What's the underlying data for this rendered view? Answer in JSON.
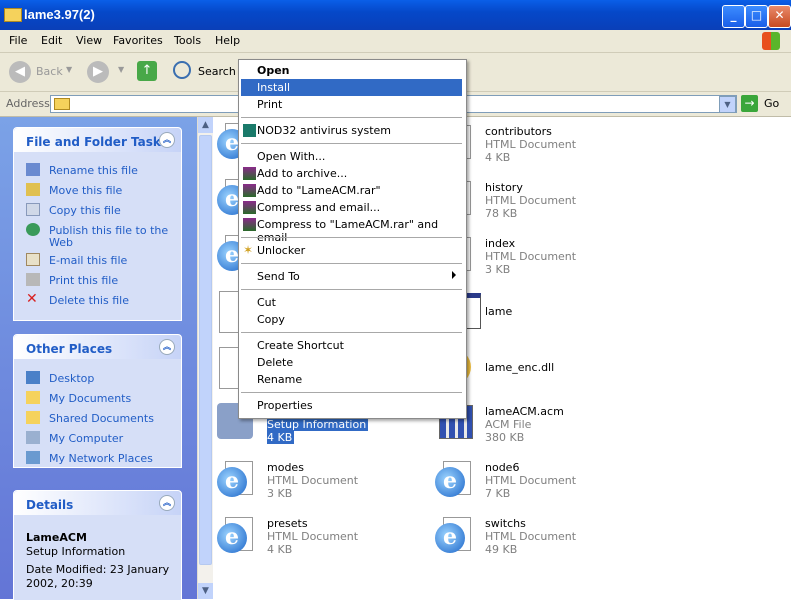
{
  "window": {
    "title": "lame3.97(2)"
  },
  "menubar": [
    "File",
    "Edit",
    "View",
    "Favorites",
    "Tools",
    "Help"
  ],
  "toolbar": {
    "back": "Back",
    "search": "Search"
  },
  "address": {
    "label": "Address",
    "value": "",
    "go": "Go"
  },
  "tasks": {
    "title": "File and Folder Tasks",
    "items": [
      "Rename this file",
      "Move this file",
      "Copy this file",
      "Publish this file to the",
      "Web",
      "E-mail this file",
      "Print this file",
      "Delete this file"
    ]
  },
  "places": {
    "title": "Other Places",
    "items": [
      "Desktop",
      "My Documents",
      "Shared Documents",
      "My Computer",
      "My Network Places"
    ]
  },
  "details": {
    "title": "Details",
    "name": "LameACM",
    "type": "Setup Information",
    "modified_line1": "Date Modified: 23 January",
    "modified_line2": "2002, 20:39"
  },
  "files_left": [
    {
      "name": "",
      "type": "",
      "size": ""
    },
    {
      "name": "",
      "type": "",
      "size": ""
    },
    {
      "name": "",
      "type": "",
      "size": ""
    },
    {
      "name": "",
      "type": "",
      "size": ""
    },
    {
      "name": "",
      "type": "",
      "size": ""
    },
    {
      "name": "",
      "type": "Setup Information",
      "size": "4 KB"
    },
    {
      "name": "modes",
      "type": "HTML Document",
      "size": "3 KB"
    },
    {
      "name": "presets",
      "type": "HTML Document",
      "size": "4 KB"
    }
  ],
  "files_right": [
    {
      "name": "contributors",
      "type": "HTML Document",
      "size": "4 KB"
    },
    {
      "name": "history",
      "type": "HTML Document",
      "size": "78 KB"
    },
    {
      "name": "index",
      "type": "HTML Document",
      "size": "3 KB"
    },
    {
      "name": "lame",
      "type": "",
      "size": ""
    },
    {
      "name": "lame_enc.dll",
      "type": "",
      "size": ""
    },
    {
      "name": "lameACM.acm",
      "type": "ACM File",
      "size": "380 KB"
    },
    {
      "name": "node6",
      "type": "HTML Document",
      "size": "7 KB"
    },
    {
      "name": "switchs",
      "type": "HTML Document",
      "size": "49 KB"
    }
  ],
  "context_menu": {
    "open": "Open",
    "install": "Install",
    "print": "Print",
    "nod32": "NOD32 antivirus system",
    "open_with": "Open With...",
    "add_archive": "Add to archive...",
    "add_rar": "Add to \"LameACM.rar\"",
    "compress_email": "Compress and email...",
    "compress_rar_email": "Compress to \"LameACM.rar\" and email",
    "unlocker": "Unlocker",
    "send_to": "Send To",
    "cut": "Cut",
    "copy": "Copy",
    "create_shortcut": "Create Shortcut",
    "delete": "Delete",
    "rename": "Rename",
    "properties": "Properties"
  }
}
